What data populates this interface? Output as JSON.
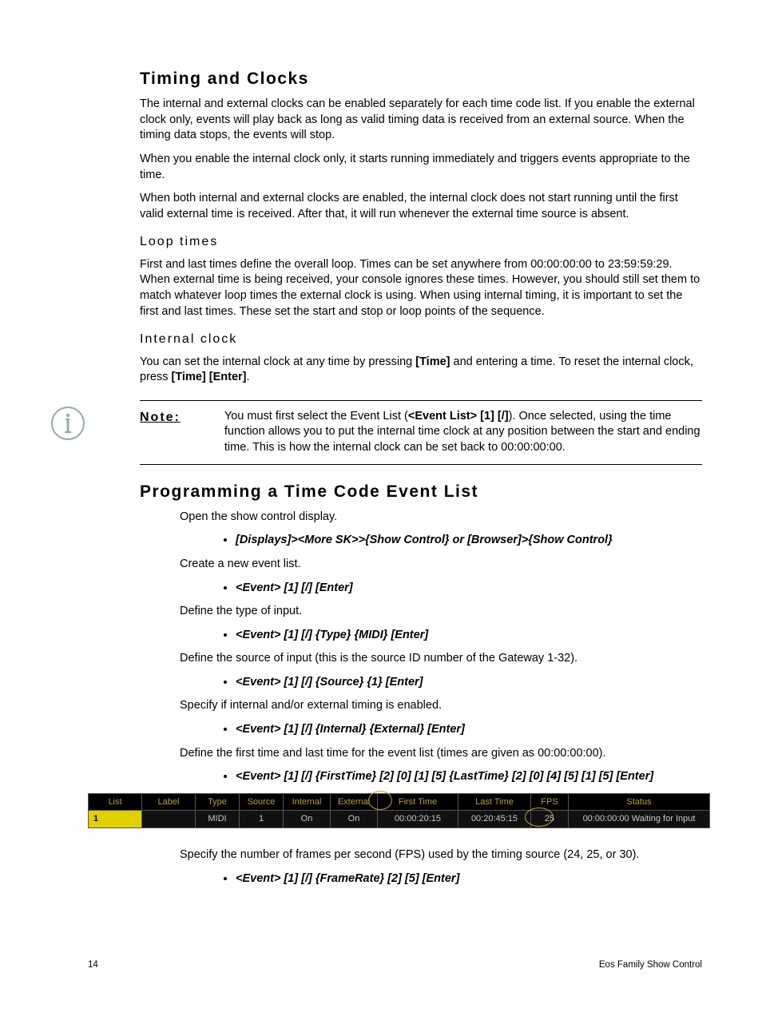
{
  "heading1": "Timing and Clocks",
  "p1": "The internal and external clocks can be enabled separately for each time code list. If you enable the external clock only, events will play back as long as valid timing data is received from an external source. When the timing data stops, the events will stop.",
  "p2": "When you enable the internal clock only, it starts running immediately and triggers events appropriate to the time.",
  "p3": "When both internal and external clocks are enabled, the internal clock does not start running until the first valid external time is received. After that, it will run whenever the external time source is absent.",
  "sub1": "Loop times",
  "p4": "First and last times define the overall loop. Times can be set anywhere from 00:00:00:00 to 23:59:59:29. When external time is being received, your console ignores these times. However, you should still set them to match whatever loop times the external clock is using. When using internal timing, it is important to set the first and last times. These set the start and stop or loop points of the sequence.",
  "sub2": "Internal clock",
  "p5a": "You can set the internal clock at any time by pressing ",
  "p5b": "[Time]",
  "p5c": " and entering a time. To reset the internal clock, press ",
  "p5d": "[Time] [Enter]",
  "p5e": ".",
  "note_label": "Note:",
  "note_a": "You must first select the Event List (",
  "note_b": "<Event List> [1] [/]",
  "note_c": "). Once selected, using the time function allows you to put the internal time clock at any position between the start and ending time. This is how the internal clock can be set back to 00:00:00:00.",
  "heading2": "Programming a Time Code Event List",
  "step1": "Open the show control display.",
  "cmd1": "[Displays]><More SK>>{Show Control} or [Browser]>{Show Control}",
  "step2": "Create a new event list.",
  "cmd2": "<Event> [1] [/] [Enter]",
  "step3": "Define the type of input.",
  "cmd3": "<Event> [1] [/] {Type} {MIDI} [Enter]",
  "step4": "Define the source of input (this is the source ID number of the Gateway 1-32).",
  "cmd4": "<Event> [1] [/] {Source} {1} [Enter]",
  "step5": "Specify if internal and/or external timing is enabled.",
  "cmd5": "<Event> [1] [/] {Internal} {External} [Enter]",
  "step6": "Define the first time and last time for the event list (times are given as 00:00:00:00).",
  "cmd6": "<Event> [1] [/] {FirstTime} [2] [0] [1] [5] {LastTime} [2] [0] [4] [5] [1] [5] [Enter]",
  "step7": "Specify the number of frames per second (FPS) used by the timing source (24, 25, or 30).",
  "cmd7": "<Event> [1] [/] {FrameRate} [2] [5] [Enter]",
  "table": {
    "headers": [
      "List",
      "Label",
      "Type",
      "Source",
      "Internal",
      "External",
      "First Time",
      "Last Time",
      "FPS",
      "Status"
    ],
    "row": {
      "list": "1",
      "label": "",
      "type": "MIDI",
      "source": "1",
      "internal": "On",
      "external": "On",
      "first_time": "00:00:20:15",
      "last_time": "00:20:45:15",
      "fps": "25",
      "status": "00:00:00:00 Waiting for Input"
    }
  },
  "footer_page": "14",
  "footer_doc": "Eos Family Show Control"
}
